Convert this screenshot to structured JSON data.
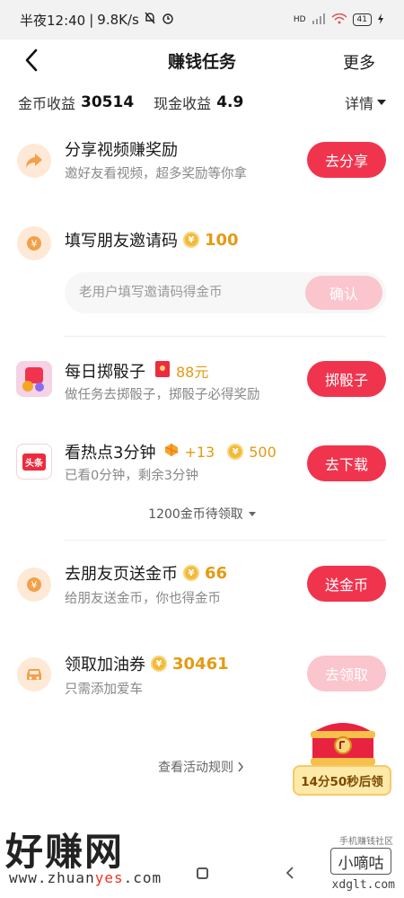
{
  "status_bar": {
    "time": "半夜12:40",
    "speed": "9.8K/s",
    "network": "HD",
    "battery": "41"
  },
  "nav": {
    "title": "赚钱任务",
    "more": "更多"
  },
  "earnings": {
    "coin_label": "金币收益",
    "coin_value": "30514",
    "cash_label": "现金收益",
    "cash_value": "4.9",
    "detail_label": "详情"
  },
  "tasks": [
    {
      "title": "分享视频赚奖励",
      "subtitle": "邀好友看视频，超多奖励等你拿",
      "button": "去分享"
    },
    {
      "title": "填写朋友邀请码",
      "reward": "100",
      "input_placeholder": "老用户填写邀请码得金币",
      "button": "确认"
    },
    {
      "title": "每日掷骰子",
      "reward": "88元",
      "subtitle": "做任务去掷骰子，掷骰子必得奖励",
      "button": "掷骰子"
    },
    {
      "title": "看热点3分钟",
      "bonus": "+13",
      "reward": "500",
      "subtitle": "已看0分钟，剩余3分钟",
      "button": "去下载",
      "icon_text": "头条",
      "pending": "1200金币待领取"
    },
    {
      "title": "去朋友页送金币",
      "reward": "66",
      "subtitle": "给朋友送金币，你也得金币",
      "button": "送金币"
    },
    {
      "title": "领取加油券",
      "reward": "30461",
      "subtitle": "只需添加爱车",
      "button": "去领取"
    }
  ],
  "rules_link": "查看活动规则",
  "chest_timer": "14分50秒后领",
  "watermark": {
    "left_text": "好赚网",
    "left_url_a": "www.zhuan",
    "left_url_b": "yes",
    "left_url_c": ".com",
    "right_small": "手机赚钱社区",
    "right_text": "小嘀咕",
    "right_url": "xdglt.com"
  },
  "colors": {
    "accent": "#f0344e",
    "accent_disabled": "#fbc5cd",
    "coin": "#e49a12",
    "icon_bg": "#fde9d6"
  }
}
